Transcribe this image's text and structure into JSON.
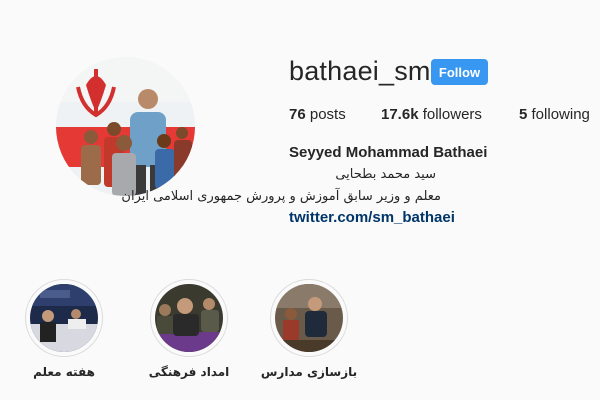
{
  "profile": {
    "username": "bathaei_sm",
    "follow_label": "Follow",
    "stats": {
      "posts_count": "76",
      "posts_label": "posts",
      "followers_count": "17.6k",
      "followers_label": "followers",
      "following_count": "5",
      "following_label": "following"
    },
    "full_name": "Seyyed Mohammad Bathaei",
    "bio_line1": "سید محمد بطحایی",
    "bio_line2": "معلم و وزیر سابق آموزش و پرورش جمهوری اسلامی ایران",
    "link": "twitter.com/sm_bathaei",
    "link_color": "#003569",
    "button_color": "#3897f0"
  },
  "highlights": [
    {
      "label": "هفته معلم",
      "icon": "classroom-photo"
    },
    {
      "label": "امداد فرهنگی",
      "icon": "people-photo"
    },
    {
      "label": "بازسازی مدارس",
      "icon": "school-photo"
    }
  ]
}
